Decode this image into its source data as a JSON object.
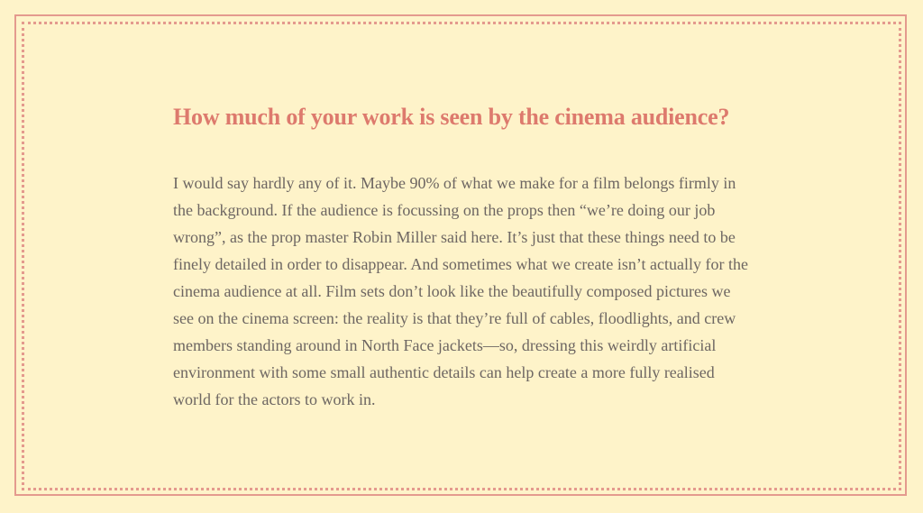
{
  "interview": {
    "question": "How much of your work is seen by the cinema audience?",
    "answer": "I would say hardly any of it. Maybe 90% of what we make for a film belongs firmly in the background. If the audience is focussing on the props then “we’re doing our job wrong”, as the prop master Robin Miller said here. It’s just that these things need to be finely detailed in order to disappear. And sometimes what we create isn’t actually for the cinema audience at all. Film sets don’t look like the beautifully composed pictures we see on the cinema screen: the reality is that they’re full of cables, floodlights, and crew members standing around in North Face jackets—so, dressing this weirdly artificial environment with some small authentic details can help create a more fully realised world for the actors to work in."
  },
  "theme": {
    "background": "#fef3c9",
    "accent": "#e49a8e",
    "heading_color": "#dd7a6d",
    "body_color": "#6d6662"
  }
}
